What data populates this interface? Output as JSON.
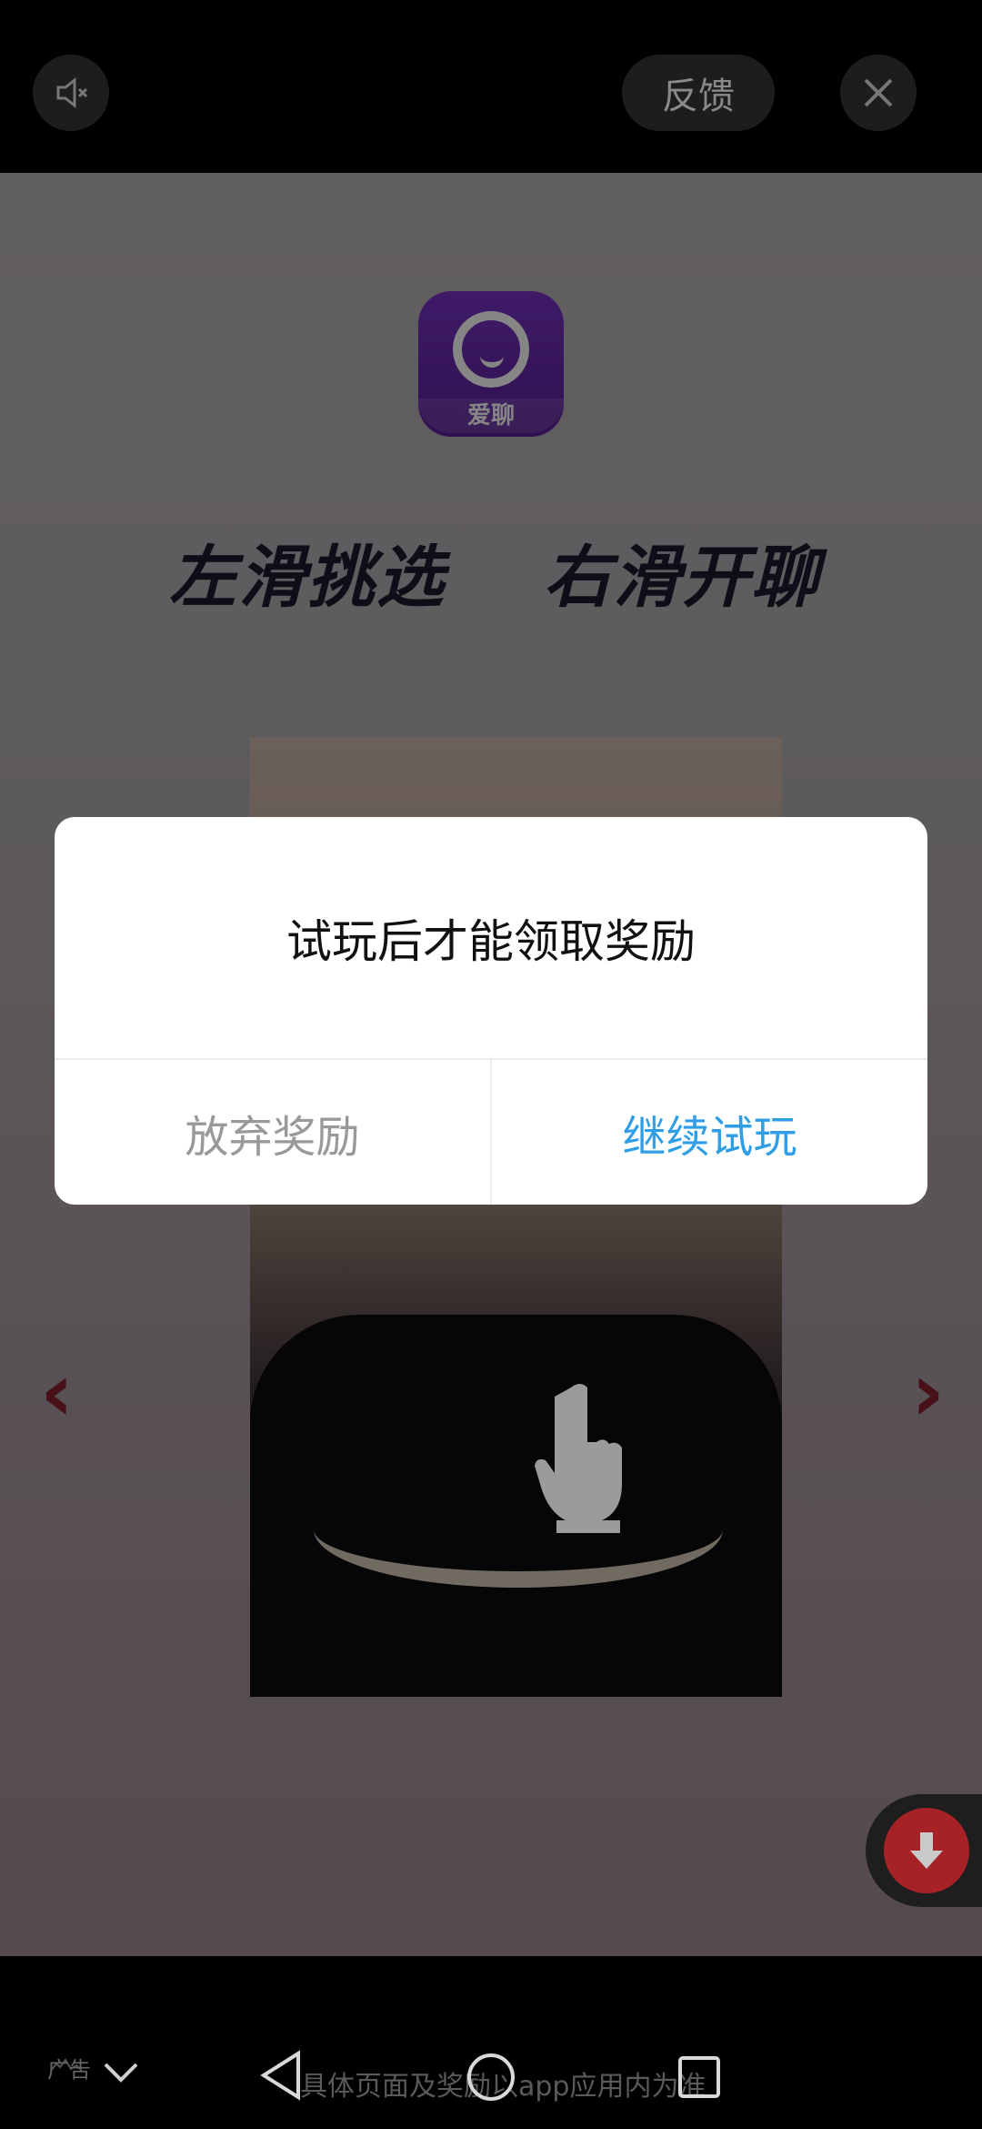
{
  "header": {
    "feedback_label": "反馈",
    "mute_icon": "speaker-muted-icon",
    "close_icon": "close-icon"
  },
  "ad": {
    "app_name": "爱聊",
    "slogan_left": "左滑挑选",
    "slogan_right": "右滑开聊",
    "download_icon": "download-arrow-icon"
  },
  "dialog": {
    "message": "试玩后才能领取奖励",
    "give_up_label": "放弃奖励",
    "continue_label": "继续试玩",
    "continue_color": "#2f9ee6"
  },
  "footer": {
    "ad_label": "广告",
    "disclaimer": "具体页面及奖励以app应用内为准"
  },
  "navbar": {
    "back_icon": "back-triangle-icon",
    "home_icon": "home-circle-icon",
    "recents_icon": "recents-square-icon",
    "collapse_icon": "chevron-down-icon"
  }
}
